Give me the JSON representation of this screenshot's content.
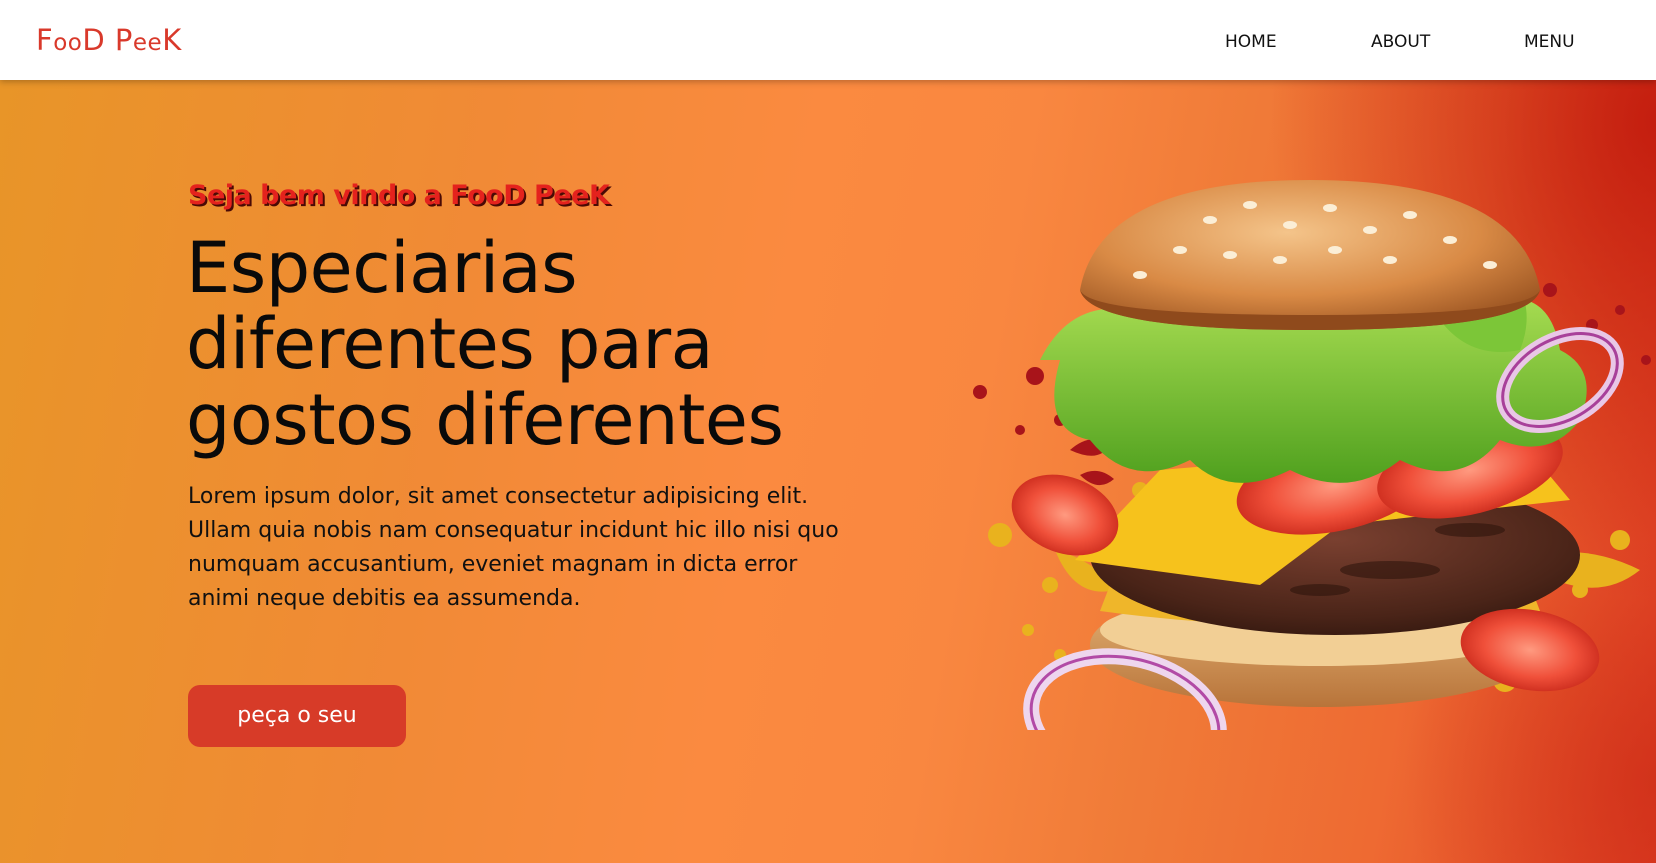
{
  "header": {
    "logo": {
      "parts": [
        "F",
        "oo",
        "D",
        " P",
        "ee",
        "K"
      ]
    },
    "nav": {
      "home": "HOME",
      "about": "ABOUT",
      "menu": "MENU"
    }
  },
  "hero": {
    "welcome": "Seja bem vindo a FooD PeeK",
    "headline": {
      "line1": "Especiarias",
      "line2": "diferentes para",
      "line3": "gostos diferentes"
    },
    "description": {
      "line1": "Lorem ipsum dolor, sit amet consectetur adipisicing elit.",
      "line2": "Ullam quia nobis nam consequatur incidunt hic illo nisi quo",
      "line3": "numquam accusantium, eveniet magnam in dicta error",
      "line4": "animi neque debitis ea assumenda."
    },
    "cta_label": "peça o seu",
    "image": "flying-burger-illustration"
  },
  "colors": {
    "brand": "#d9392b",
    "cta": "#d73b28",
    "welcome": "#e4221d",
    "hero_orange": "#fb8a40",
    "hero_red": "#c8160c"
  }
}
